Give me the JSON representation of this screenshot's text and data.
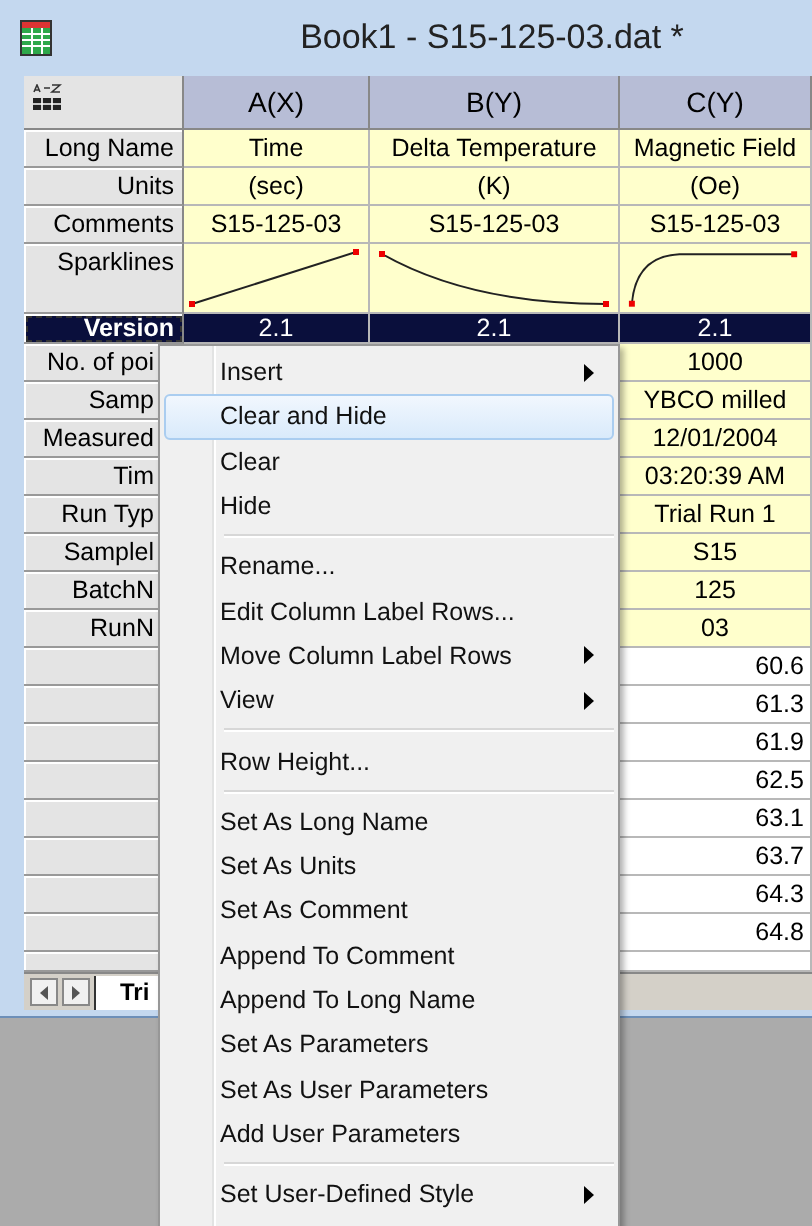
{
  "window": {
    "title": "Book1 - S15-125-03.dat *"
  },
  "columns": [
    {
      "header": "A(X)"
    },
    {
      "header": "B(Y)"
    },
    {
      "header": "C(Y)"
    }
  ],
  "label_rows": [
    {
      "label": "Long Name",
      "cells": [
        "Time",
        "Delta Temperature",
        "Magnetic Field"
      ]
    },
    {
      "label": "Units",
      "cells": [
        "(sec)",
        "(K)",
        "(Oe)"
      ]
    },
    {
      "label": "Comments",
      "cells": [
        "S15-125-03",
        "S15-125-03",
        "S15-125-03"
      ]
    }
  ],
  "sparklines": {
    "label": "Sparklines"
  },
  "version_row": {
    "label": "Version",
    "cells": [
      "2.1",
      "2.1",
      "2.1"
    ],
    "selected": true
  },
  "covered_label_rows": [
    {
      "label": "No. of poi",
      "value": "1000"
    },
    {
      "label": "Samp",
      "value": "YBCO milled"
    },
    {
      "label": "Measured",
      "value": "12/01/2004"
    },
    {
      "label": "Tim",
      "value": "03:20:39 AM"
    },
    {
      "label": "Run Typ",
      "value": "Trial Run 1"
    },
    {
      "label": "Samplel",
      "value": "S15"
    },
    {
      "label": "BatchN",
      "value": "125"
    },
    {
      "label": "RunN",
      "value": "03"
    }
  ],
  "data_rows": [
    {
      "value": "60.6"
    },
    {
      "value": "61.3"
    },
    {
      "value": "61.9"
    },
    {
      "value": "62.5"
    },
    {
      "value": "63.1"
    },
    {
      "value": "63.7"
    },
    {
      "value": "64.3"
    },
    {
      "value": "64.8"
    }
  ],
  "sheet_tabs": [
    {
      "label": "Tri",
      "selected": true
    }
  ],
  "context_menu": {
    "items": [
      {
        "kind": "item",
        "label": "Insert",
        "submenu": true,
        "selected": false
      },
      {
        "kind": "item",
        "label": "Clear and Hide",
        "submenu": false,
        "selected": true
      },
      {
        "kind": "item",
        "label": "Clear",
        "submenu": false,
        "selected": false
      },
      {
        "kind": "item",
        "label": "Hide",
        "submenu": false,
        "selected": false
      },
      {
        "kind": "separator"
      },
      {
        "kind": "item",
        "label": "Rename...",
        "submenu": false,
        "selected": false
      },
      {
        "kind": "item",
        "label": "Edit Column Label Rows...",
        "submenu": false,
        "selected": false
      },
      {
        "kind": "item",
        "label": "Move Column Label Rows",
        "submenu": true,
        "selected": false
      },
      {
        "kind": "item",
        "label": "View",
        "submenu": true,
        "selected": false
      },
      {
        "kind": "separator"
      },
      {
        "kind": "item",
        "label": "Row Height...",
        "submenu": false,
        "selected": false
      },
      {
        "kind": "separator"
      },
      {
        "kind": "item",
        "label": "Set As Long Name",
        "submenu": false,
        "selected": false
      },
      {
        "kind": "item",
        "label": "Set As Units",
        "submenu": false,
        "selected": false
      },
      {
        "kind": "item",
        "label": "Set As Comment",
        "submenu": false,
        "selected": false
      },
      {
        "kind": "item",
        "label": "Append To Comment",
        "submenu": false,
        "selected": false
      },
      {
        "kind": "item",
        "label": "Append To Long Name",
        "submenu": false,
        "selected": false
      },
      {
        "kind": "item",
        "label": "Set As Parameters",
        "submenu": false,
        "selected": false
      },
      {
        "kind": "item",
        "label": "Set As User Parameters",
        "submenu": false,
        "selected": false
      },
      {
        "kind": "item",
        "label": "Add User Parameters",
        "submenu": false,
        "selected": false
      },
      {
        "kind": "separator"
      },
      {
        "kind": "item",
        "label": "Set User-Defined Style",
        "submenu": true,
        "selected": false
      }
    ]
  }
}
